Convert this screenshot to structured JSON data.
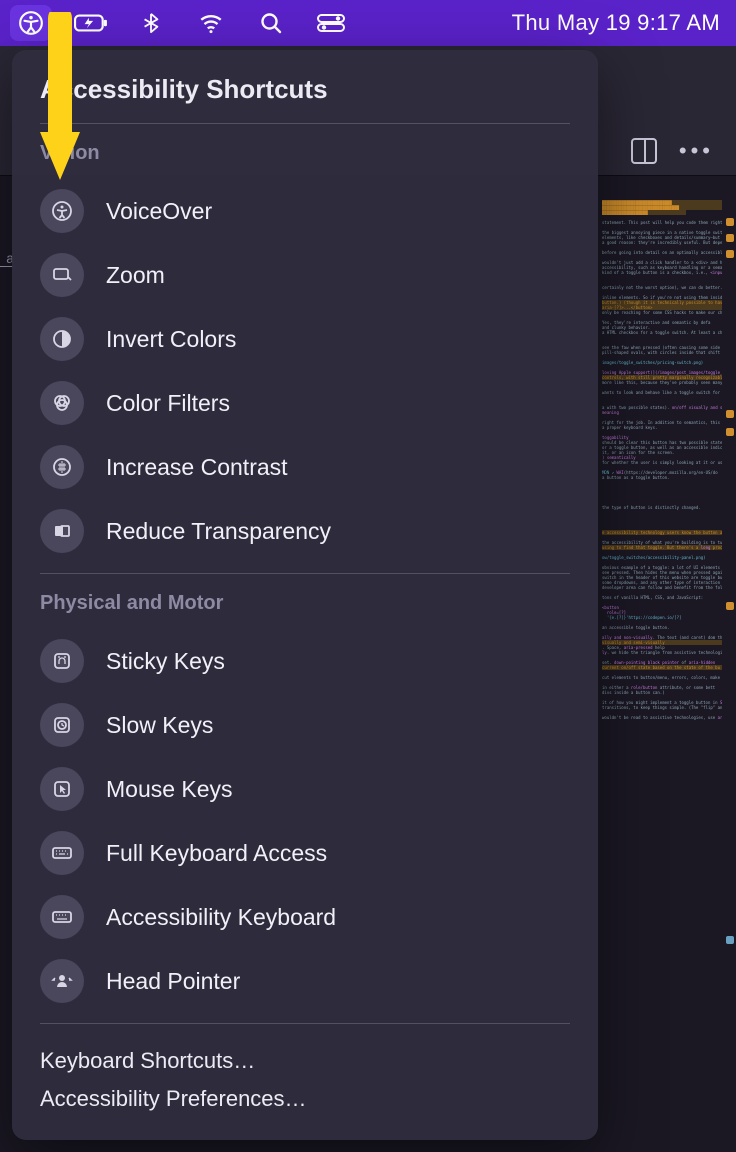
{
  "menubar": {
    "clock": "Thu May 19  9:17 AM"
  },
  "popup": {
    "title": "Accessibility Shortcuts",
    "sections": [
      {
        "title": "Vision",
        "items": [
          {
            "label": "VoiceOver"
          },
          {
            "label": "Zoom"
          },
          {
            "label": "Invert Colors"
          },
          {
            "label": "Color Filters"
          },
          {
            "label": "Increase Contrast"
          },
          {
            "label": "Reduce Transparency"
          }
        ]
      },
      {
        "title": "Physical and Motor",
        "items": [
          {
            "label": "Sticky Keys"
          },
          {
            "label": "Slow Keys"
          },
          {
            "label": "Mouse Keys"
          },
          {
            "label": "Full Keyboard Access"
          },
          {
            "label": "Accessibility Keyboard"
          },
          {
            "label": "Head Pointer"
          }
        ]
      }
    ],
    "footer": [
      "Keyboard Shortcuts…",
      "Accessibility Preferences…"
    ]
  }
}
